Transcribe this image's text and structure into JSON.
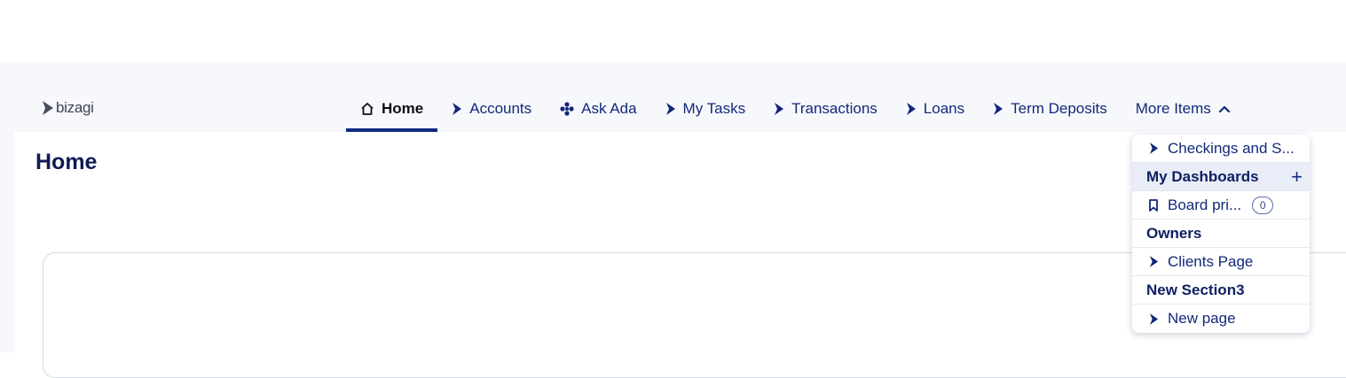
{
  "brand": {
    "name": "bizagi"
  },
  "nav": {
    "items": [
      {
        "label": "Home",
        "icon": "home-icon",
        "active": true
      },
      {
        "label": "Accounts",
        "icon": "bizagi-icon"
      },
      {
        "label": "Ask Ada",
        "icon": "ada-icon"
      },
      {
        "label": "My Tasks",
        "icon": "bizagi-icon"
      },
      {
        "label": "Transactions",
        "icon": "bizagi-icon"
      },
      {
        "label": "Loans",
        "icon": "bizagi-icon"
      },
      {
        "label": "Term Deposits",
        "icon": "bizagi-icon"
      }
    ],
    "more_label": "More Items"
  },
  "page": {
    "title": "Home"
  },
  "more_menu": {
    "checkings_label": "Checkings and S...",
    "dashboards_header": "My Dashboards",
    "add_symbol": "+",
    "board_label": "Board pri...",
    "board_count": "0",
    "owners_header": "Owners",
    "clients_label": "Clients Page",
    "section3_header": "New Section3",
    "new_page_label": "New page"
  },
  "colors": {
    "primary": "#0e2a80",
    "nav_text": "#13297a",
    "background": "#f7f8fc"
  }
}
